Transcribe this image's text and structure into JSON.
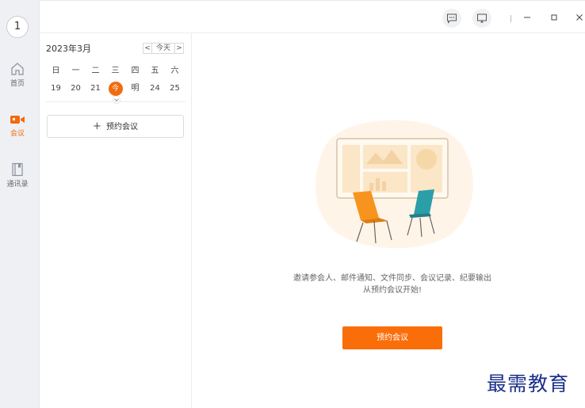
{
  "rail": {
    "avatar_text": "1",
    "items": [
      {
        "label": "首页",
        "icon": "home-icon",
        "active": false
      },
      {
        "label": "会议",
        "icon": "meeting-camera-icon",
        "active": true
      },
      {
        "label": "通讯录",
        "icon": "contacts-book-icon",
        "active": false
      }
    ]
  },
  "titlebar": {
    "buttons": [
      "feedback-icon",
      "screen-share-icon",
      "minimize-icon",
      "maximize-icon",
      "close-icon"
    ]
  },
  "calendar": {
    "month_label": "2023年3月",
    "prev_label": "<",
    "today_label": "今天",
    "next_label": ">",
    "weekdays": [
      "日",
      "一",
      "二",
      "三",
      "四",
      "五",
      "六"
    ],
    "days": [
      "19",
      "20",
      "21",
      "今",
      "明",
      "24",
      "25"
    ],
    "today_index": 3
  },
  "reserve_button_label": "预约会议",
  "empty_state": {
    "line1": "邀请参会人、邮件通知、文件同步、会议记录、纪要输出",
    "line2": "从预约会议开始!",
    "cta_label": "预约会议"
  },
  "watermark": "最需教育",
  "colors": {
    "accent": "#fa6e0a",
    "rail_bg": "#eef0f3",
    "watermark": "#1a2f8a"
  }
}
